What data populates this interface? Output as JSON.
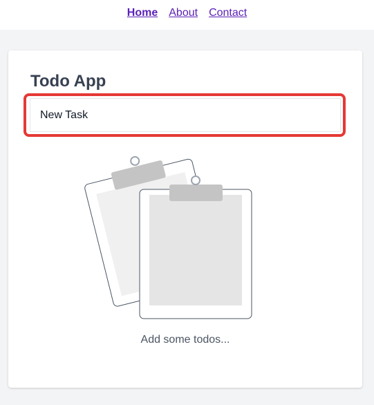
{
  "nav": {
    "items": [
      {
        "label": "Home",
        "active": true
      },
      {
        "label": "About",
        "active": false
      },
      {
        "label": "Contact",
        "active": false
      }
    ]
  },
  "app": {
    "title": "Todo App",
    "input": {
      "value": "",
      "placeholder": "New Task"
    },
    "empty_state": {
      "icon": "clipboards-illustration",
      "message": "Add some todos..."
    }
  },
  "colors": {
    "link": "#5b21b6",
    "highlight": "#e53935",
    "background": "#f3f4f6"
  }
}
